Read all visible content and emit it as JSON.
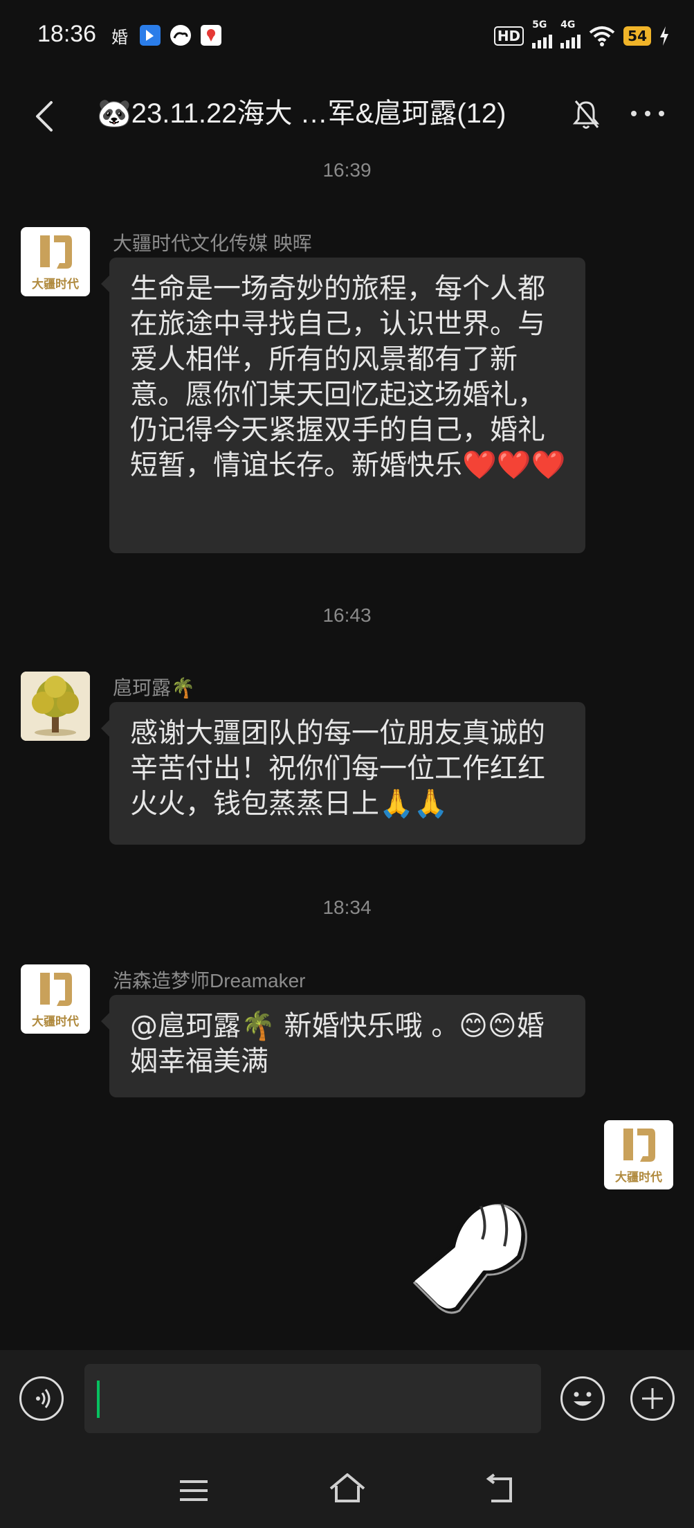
{
  "status_bar": {
    "time": "18:36",
    "left_icons": [
      "wedding-char-icon",
      "bluetooth-app-icon",
      "cloud-app-icon",
      "map-app-icon"
    ],
    "wedding_char": "婚",
    "hd_label": "HD",
    "sim1_label": "5G",
    "sim2_label": "4G",
    "battery_level": "54"
  },
  "header": {
    "title": "🐼23.11.22海大 …军&扈珂露(12)"
  },
  "messages": [
    {
      "timestamp": "16:39",
      "sender": "大疆时代文化传媒 映晖",
      "avatar_label": "大疆时代",
      "text": "生命是一场奇妙的旅程，每个人都在旅途中寻找自己，认识世界。与爱人相伴，所有的风景都有了新意。愿你们某天回忆起这场婚礼，仍记得今天紧握双手的自己，婚礼短暂，情谊长存。新婚快乐",
      "emoji": "❤️❤️❤️"
    },
    {
      "timestamp": "16:43",
      "sender": "扈珂露🌴",
      "text": "感谢大疆团队的每一位朋友真诚的辛苦付出！祝你们每一位工作红红火火，钱包蒸蒸日上🙏🙏"
    },
    {
      "timestamp": "18:34",
      "sender": "浩森造梦师Dreamaker",
      "avatar_label": "大疆时代",
      "text": "@扈珂露🌴 新婚快乐哦 。😊😊婚姻幸福美满"
    }
  ],
  "self_avatar_label": "大疆时代",
  "colors": {
    "background": "#111111",
    "bubble": "#2c2c2c",
    "caret": "#07c160",
    "battery": "#f0b429",
    "logo_gold": "#c9a15a"
  }
}
